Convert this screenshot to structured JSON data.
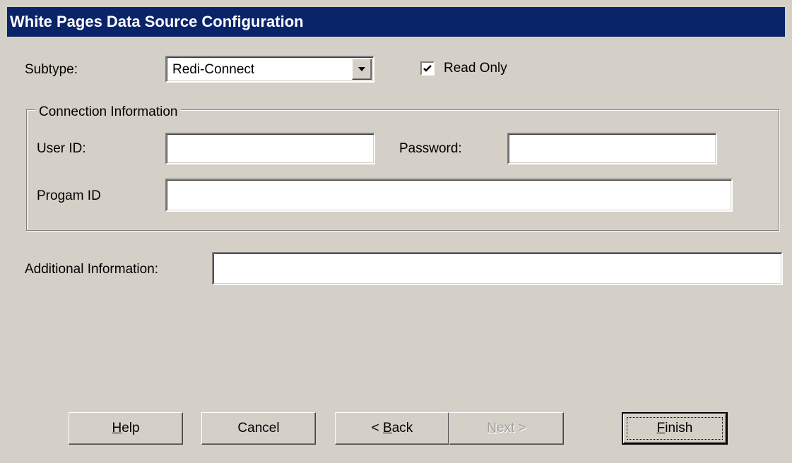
{
  "window": {
    "title": "White Pages Data Source Configuration"
  },
  "subtype": {
    "label": "Subtype:",
    "value": "Redi-Connect"
  },
  "read_only": {
    "label": "Read Only",
    "checked": true
  },
  "connection": {
    "group_title": "Connection Information",
    "user_id_label": "User ID:",
    "user_id_value": "",
    "password_label": "Password:",
    "password_value": "",
    "program_id_label": "Progam ID",
    "program_id_value": ""
  },
  "additional": {
    "label": "Additional Information:",
    "value": ""
  },
  "buttons": {
    "help": {
      "mnemonic": "H",
      "rest": "elp"
    },
    "cancel": {
      "label": "Cancel"
    },
    "back": {
      "prefix": "< ",
      "mnemonic": "B",
      "rest": "ack"
    },
    "next": {
      "mnemonic": "N",
      "rest": "ext >",
      "enabled": false
    },
    "finish": {
      "mnemonic": "F",
      "rest": "inish"
    }
  },
  "icons": {
    "dropdown": "chevron-down-icon",
    "checkbox": "checkmark-icon"
  }
}
